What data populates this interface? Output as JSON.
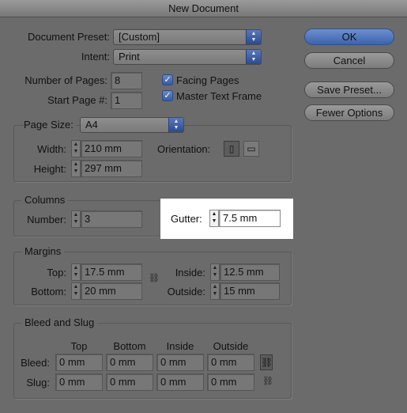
{
  "window": {
    "title": "New Document"
  },
  "document_preset": {
    "label": "Document Preset:",
    "value": "[Custom]"
  },
  "intent": {
    "label": "Intent:",
    "value": "Print"
  },
  "pages": {
    "number_label": "Number of Pages:",
    "number_value": "8",
    "start_label": "Start Page #:",
    "start_value": "1"
  },
  "options": {
    "facing_pages": "Facing Pages",
    "master_text_frame": "Master Text Frame"
  },
  "buttons": {
    "ok": "OK",
    "cancel": "Cancel",
    "save_preset": "Save Preset...",
    "fewer_options": "Fewer Options"
  },
  "page_size": {
    "label": "Page Size:",
    "value": "A4",
    "width_label": "Width:",
    "width_value": "210 mm",
    "height_label": "Height:",
    "height_value": "297 mm",
    "orientation_label": "Orientation:"
  },
  "columns": {
    "title": "Columns",
    "number_label": "Number:",
    "number_value": "3",
    "gutter_label": "Gutter:",
    "gutter_value": "7.5 mm"
  },
  "margins": {
    "title": "Margins",
    "top_label": "Top:",
    "top_value": "17.5 mm",
    "bottom_label": "Bottom:",
    "bottom_value": "20 mm",
    "inside_label": "Inside:",
    "inside_value": "12.5 mm",
    "outside_label": "Outside:",
    "outside_value": "15 mm"
  },
  "bleed_slug": {
    "title": "Bleed and Slug",
    "headers": [
      "Top",
      "Bottom",
      "Inside",
      "Outside"
    ],
    "bleed_label": "Bleed:",
    "bleed_values": [
      "0 mm",
      "0 mm",
      "0 mm",
      "0 mm"
    ],
    "slug_label": "Slug:",
    "slug_values": [
      "0 mm",
      "0 mm",
      "0 mm",
      "0 mm"
    ]
  },
  "icons": {
    "popup_arrows": "▲▼",
    "stepper": "▲▼",
    "check": "✓",
    "portrait": "▯",
    "landscape": "▭",
    "chain": "⛓"
  }
}
